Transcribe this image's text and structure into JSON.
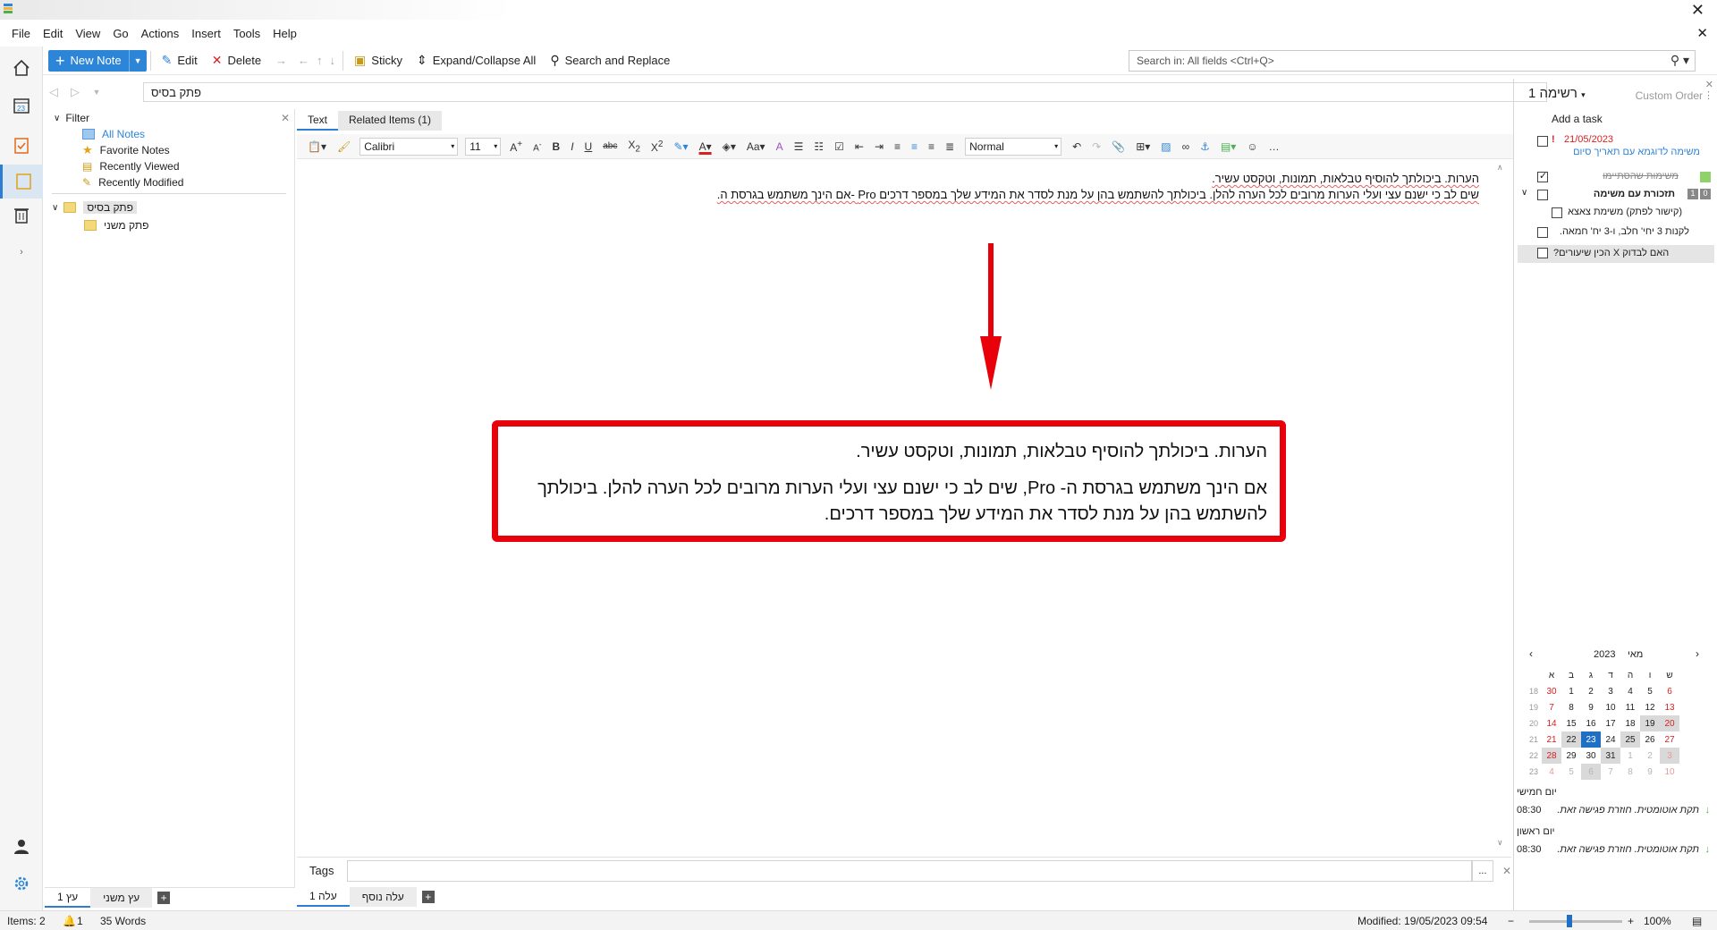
{
  "menu": [
    "File",
    "Edit",
    "View",
    "Go",
    "Actions",
    "Insert",
    "Tools",
    "Help"
  ],
  "toolbar": {
    "new_note": "New Note",
    "edit": "Edit",
    "delete": "Delete",
    "sticky": "Sticky",
    "expand_collapse": "Expand/Collapse All",
    "search_replace": "Search and Replace",
    "search_placeholder": "Search in: All fields  <Ctrl+Q>"
  },
  "breadcrumb": "פתק בסיס",
  "tree": {
    "filter_label": "Filter",
    "items": [
      "All Notes",
      "Favorite Notes",
      "Recently Viewed",
      "Recently Modified"
    ],
    "folders": [
      "פתק בסיס",
      "פתק משני"
    ],
    "tabs": [
      "עץ 1",
      "עץ משני"
    ]
  },
  "editor": {
    "tabs": [
      "Text",
      "Related Items  (1)"
    ],
    "font": "Calibri",
    "size": "11",
    "style": "Normal",
    "line1": "הערות. ביכולתך להוסיף טבלאות, תמונות, וטקסט עשיר.",
    "line2": "שים לב כי ישנם עצי ועלי הערות מרובים לכל הערה להלן.  ביכולתך להשתמש בהן על מנת לסדר את המידע שלך במספר דרכים  Pro -אם הינך משתמש בגרסת ה."
  },
  "callout": {
    "para1": "הערות. ביכולתך להוסיף טבלאות, תמונות, וטקסט עשיר.",
    "para2": "אם הינך משתמש בגרסת ה- Pro, שים לב כי ישנם עצי ועלי הערות מרובים לכל הערה להלן. ביכולתך להשתמש בהן על מנת לסדר את המידע שלך במספר דרכים."
  },
  "tags_label": "Tags",
  "page_tabs": [
    "עלה 1",
    "עלה נוסף"
  ],
  "right_panel": {
    "list_title": "רשימה 1",
    "order": "Custom Order",
    "add_task": "Add a task",
    "tasks": [
      {
        "date": "21/05/2023",
        "text": "משימה לדוגמא עם תאריך סיום"
      },
      {
        "text": "משימות שהסתיימו"
      },
      {
        "text": "תזכורת עם משימה"
      },
      {
        "text": "(קישור לפתק) משימת צאצא"
      },
      {
        "text": "לקנות 3 יחי' חלב, ו-3 יח' חמאה."
      },
      {
        "text": "האם לבדוק X הכין שיעורים?"
      }
    ],
    "calendar": {
      "month": "מאי",
      "year": "2023",
      "weekdays": [
        "א",
        "ב",
        "ג",
        "ד",
        "ה",
        "ו",
        "ש"
      ],
      "weeks": [
        {
          "wk": "18",
          "days": [
            "30",
            "1",
            "2",
            "3",
            "4",
            "5",
            "6"
          ]
        },
        {
          "wk": "19",
          "days": [
            "7",
            "8",
            "9",
            "10",
            "11",
            "12",
            "13"
          ]
        },
        {
          "wk": "20",
          "days": [
            "14",
            "15",
            "16",
            "17",
            "18",
            "19",
            "20"
          ]
        },
        {
          "wk": "21",
          "days": [
            "21",
            "22",
            "23",
            "24",
            "25",
            "26",
            "27"
          ]
        },
        {
          "wk": "22",
          "days": [
            "28",
            "29",
            "30",
            "31",
            "1",
            "2",
            "3"
          ]
        },
        {
          "wk": "23",
          "days": [
            "4",
            "5",
            "6",
            "7",
            "8",
            "9",
            "10"
          ]
        }
      ]
    },
    "agenda": [
      {
        "day": "יום חמישי",
        "time": "08:30",
        "event": "תקת אוטומטית. חוזרת פגישה זאת."
      },
      {
        "day": "יום ראשון",
        "time": "08:30",
        "event": "תקת אוטומטית. חוזרת פגישה זאת."
      }
    ]
  },
  "status": {
    "items": "Items: 2",
    "reminders": "1",
    "words": "35 Words",
    "modified": "Modified: 19/05/2023 09:54",
    "zoom": "100%"
  }
}
